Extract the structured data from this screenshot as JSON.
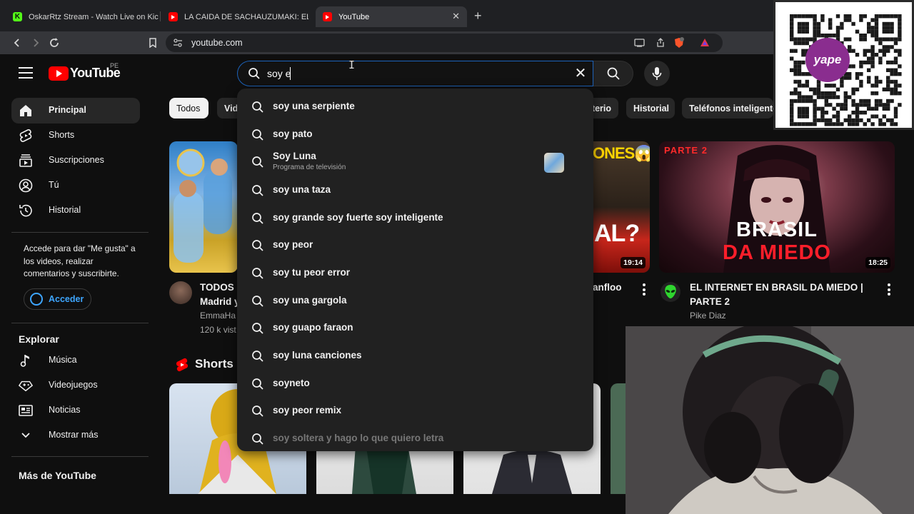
{
  "browser": {
    "tabs": [
      {
        "title": "OskarRtz Stream - Watch Live on Kick",
        "favicon": "kick-icon",
        "color": "#53fc18"
      },
      {
        "title": "LA CAIDA DE SACHAUZUMAKI: EL ST",
        "favicon": "youtube-icon",
        "color": "#ff0000"
      },
      {
        "title": "YouTube",
        "favicon": "youtube-icon",
        "color": "#ff0000",
        "active": true
      }
    ],
    "new_tab": "+",
    "close_tab": "✕",
    "url": "youtube.com"
  },
  "masthead": {
    "logo": "YouTube",
    "country": "PE",
    "search_query": "soy e",
    "clear": "✕"
  },
  "sidebar": {
    "main": [
      {
        "label": "Principal",
        "icon": "home-icon",
        "active": true
      },
      {
        "label": "Shorts",
        "icon": "shorts-icon"
      },
      {
        "label": "Suscripciones",
        "icon": "subscriptions-icon"
      },
      {
        "label": "Tú",
        "icon": "you-icon"
      },
      {
        "label": "Historial",
        "icon": "history-icon"
      }
    ],
    "signin_prompt": "Accede para dar \"Me gusta\" a los videos, realizar comentarios y suscribirte.",
    "signin_button": "Acceder",
    "explore_heading": "Explorar",
    "explore": [
      {
        "label": "Música",
        "icon": "music-icon"
      },
      {
        "label": "Videojuegos",
        "icon": "gaming-icon"
      },
      {
        "label": "Noticias",
        "icon": "news-icon"
      },
      {
        "label": "Mostrar más",
        "icon": "chevron-down-icon"
      }
    ],
    "more_heading": "Más de YouTube"
  },
  "chips": [
    "Todos",
    "Vid",
    "terio",
    "Historial",
    "Teléfonos inteligente"
  ],
  "suggestions": [
    {
      "text": "soy una serpiente"
    },
    {
      "text": "soy pato"
    },
    {
      "text": "Soy Luna",
      "sub": "Programa de televisión",
      "has_thumb": true
    },
    {
      "text": "soy una taza"
    },
    {
      "text": "soy grande soy fuerte soy inteligente"
    },
    {
      "text": "soy peor"
    },
    {
      "text": "soy tu peor error"
    },
    {
      "text": "soy una gargola"
    },
    {
      "text": "soy guapo faraon"
    },
    {
      "text": "soy luna canciones"
    },
    {
      "text": "soyneto"
    },
    {
      "text": "soy peor remix"
    },
    {
      "text": "soy soltera y hago lo que quiero letra"
    }
  ],
  "videos": [
    {
      "title_line1": "TODOS L",
      "title_line2": "Madrid y",
      "channel": "EmmaHa",
      "views": "120 k vist"
    },
    {
      "thumb_text_top": "ONES😱",
      "thumb_text_mid": "AL?",
      "duration": "19:14",
      "title_fragment": "anfloo"
    },
    {
      "thumb_badge": "PARTE 2",
      "thumb_text_1": "BRASIL",
      "thumb_text_2": "DA MIEDO",
      "duration": "18:25",
      "title": "EL INTERNET EN BRASIL DA MIEDO | PARTE 2",
      "channel": "Pike Diaz"
    }
  ],
  "shorts_heading": "Shorts",
  "overlay": {
    "qr_brand": "yape"
  },
  "colors": {
    "accent_blue": "#3ea6ff",
    "youtube_red": "#ff0000",
    "background": "#0f0f0f"
  }
}
